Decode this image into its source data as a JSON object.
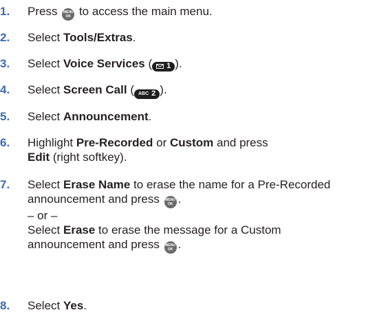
{
  "steps": [
    {
      "num": "1.",
      "pre": "Press",
      "post": "to access the main menu."
    },
    {
      "num": "2.",
      "pre": "Select",
      "bold": "Tools/Extras",
      "post": "."
    },
    {
      "num": "3.",
      "pre": "Select",
      "bold": "Voice Services",
      "paren_open": "(",
      "paren_close": ")."
    },
    {
      "num": "4.",
      "pre": "Select",
      "bold": "Screen Call",
      "paren_open": "(",
      "paren_close": ")."
    },
    {
      "num": "5.",
      "pre": "Select",
      "bold": "Announcement",
      "post": "."
    },
    {
      "num": "6.",
      "pre": "Highlight",
      "bold1": "Pre-Recorded",
      "mid1": "or",
      "bold2": "Custom",
      "mid2": "and press",
      "bold3": "Edit",
      "post": "(right softkey)."
    },
    {
      "num": "7.",
      "a_pre": "Select",
      "a_bold": "Erase Name",
      "a_mid": "to erase the name for a Pre-Recorded",
      "a_line2": "announcement and press",
      "a_end": ".",
      "or": "– or –",
      "b_pre": "Select",
      "b_bold": "Erase",
      "b_mid": "to erase the message for a Custom",
      "b_line2": "announcement and press",
      "b_end": "."
    },
    {
      "num": "8.",
      "pre": "Select",
      "bold": "Yes",
      "post": "."
    }
  ],
  "keys": {
    "menu_ok": {
      "top": "MENU",
      "bottom": "OK"
    },
    "key1": {
      "glyph": "1"
    },
    "key2": {
      "label": "ABC",
      "glyph": "2"
    }
  },
  "colors": {
    "step_number": "#3b6ab4",
    "text": "#231f20",
    "key_dark": "#1f1f1f",
    "key_gray": "#6a6a6a"
  }
}
